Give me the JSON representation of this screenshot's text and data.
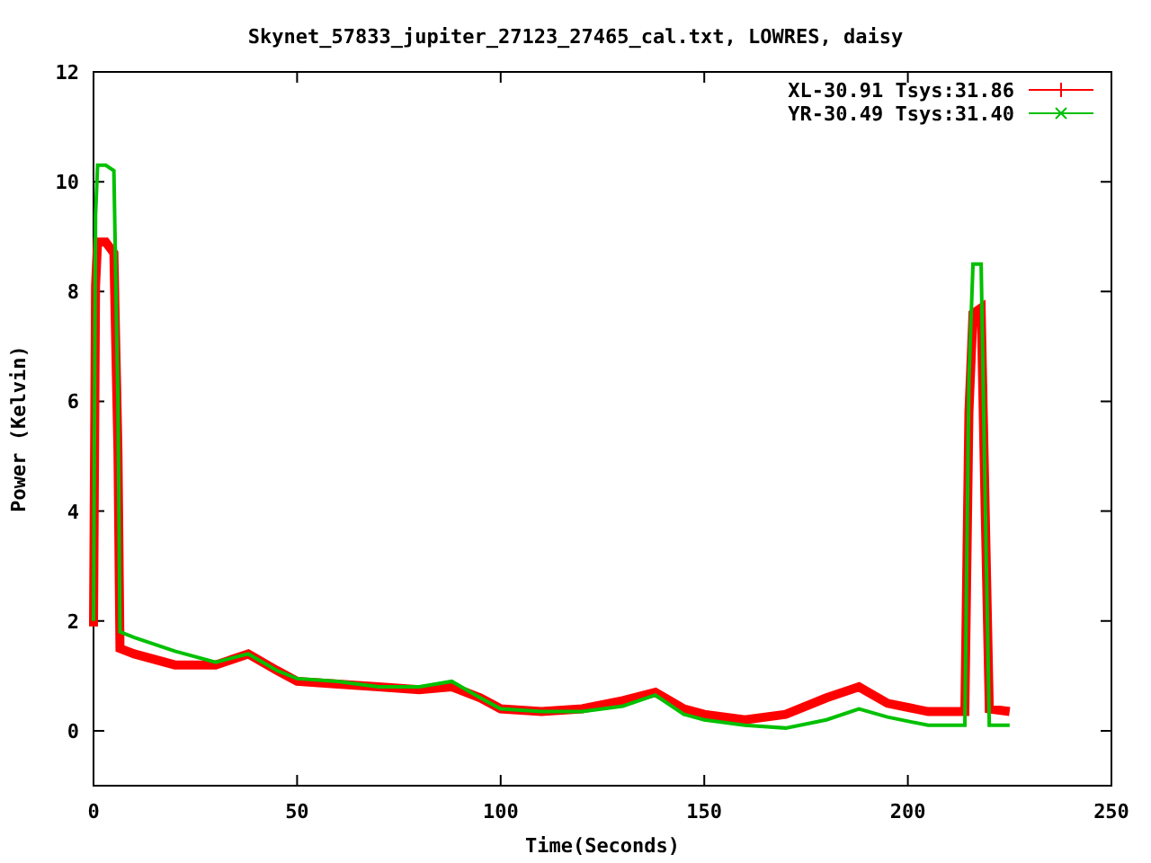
{
  "chart_data": {
    "type": "line",
    "title": "Skynet_57833_jupiter_27123_27465_cal.txt, LOWRES, daisy",
    "xlabel": "Time(Seconds)",
    "ylabel": "Power (Kelvin)",
    "x": [
      0,
      0.5,
      1,
      3,
      5,
      6,
      6.5,
      10,
      20,
      30,
      38,
      45,
      50,
      60,
      70,
      80,
      88,
      95,
      100,
      110,
      120,
      130,
      138,
      145,
      150,
      160,
      170,
      180,
      188,
      195,
      205,
      214,
      215,
      216,
      218,
      219,
      220,
      225
    ],
    "series": [
      {
        "name": "XL-30.91 Tsys:31.86",
        "color": "#ff0000",
        "values": [
          1.9,
          8.1,
          8.9,
          8.9,
          8.7,
          5.1,
          1.5,
          1.4,
          1.2,
          1.2,
          1.4,
          1.1,
          0.9,
          0.85,
          0.8,
          0.75,
          0.8,
          0.6,
          0.4,
          0.35,
          0.4,
          0.55,
          0.7,
          0.4,
          0.3,
          0.2,
          0.3,
          0.6,
          0.8,
          0.5,
          0.35,
          0.35,
          5.8,
          7.6,
          7.7,
          4.0,
          0.4,
          0.35
        ]
      },
      {
        "name": "YR-30.49 Tsys:31.40",
        "color": "#00c000",
        "values": [
          2.0,
          9.4,
          10.3,
          10.3,
          10.2,
          6.0,
          1.8,
          1.7,
          1.45,
          1.25,
          1.4,
          1.1,
          0.95,
          0.9,
          0.8,
          0.8,
          0.9,
          0.6,
          0.4,
          0.35,
          0.35,
          0.45,
          0.65,
          0.3,
          0.2,
          0.1,
          0.05,
          0.2,
          0.4,
          0.25,
          0.1,
          0.1,
          6.4,
          8.5,
          8.5,
          4.2,
          0.1,
          0.1
        ]
      }
    ],
    "legend": "upper right",
    "xlim": [
      0,
      250
    ],
    "ylim": [
      -1,
      12
    ],
    "xticks": [
      0,
      50,
      100,
      150,
      200,
      250
    ],
    "yticks": [
      0,
      2,
      4,
      6,
      8,
      10,
      12
    ]
  }
}
